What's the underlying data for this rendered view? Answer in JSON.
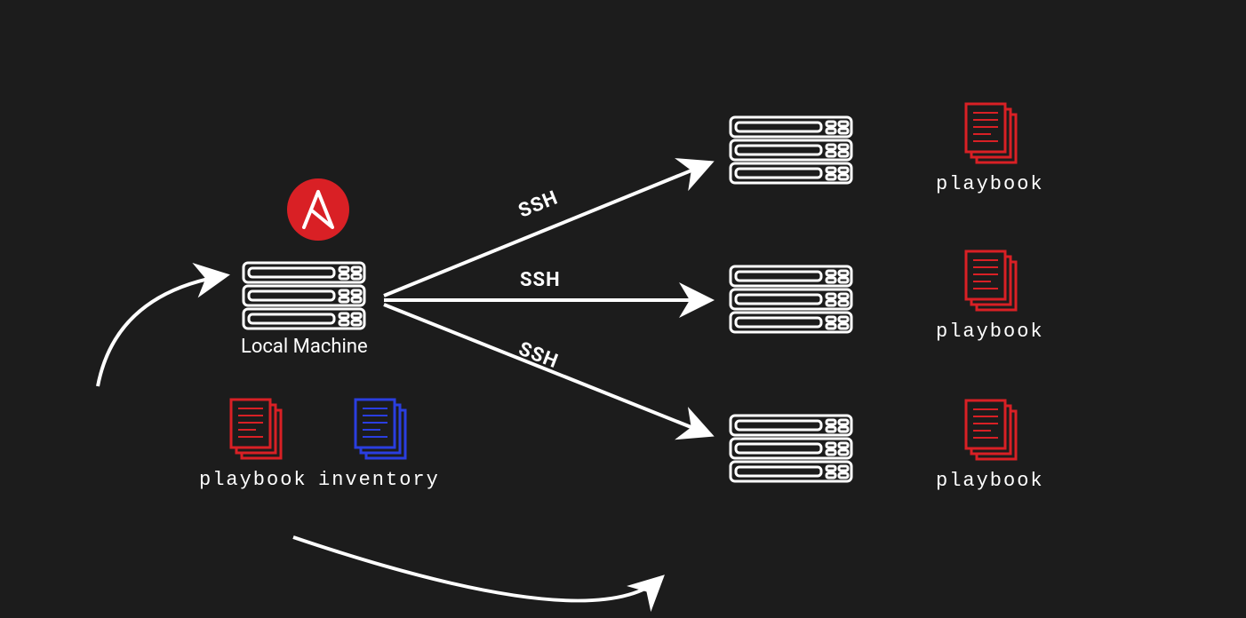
{
  "local": {
    "label": "Local Machine",
    "playbook_label": "playbook",
    "inventory_label": "inventory",
    "logo_letter": "A",
    "logo_color": "#d92025"
  },
  "connections": {
    "label": "SSH"
  },
  "remotes": [
    {
      "label": "playbook"
    },
    {
      "label": "playbook"
    },
    {
      "label": "playbook"
    }
  ],
  "colors": {
    "playbook": "#d92025",
    "inventory": "#2a3ee0",
    "stroke": "#ffffff",
    "bg": "#1c1c1c"
  }
}
